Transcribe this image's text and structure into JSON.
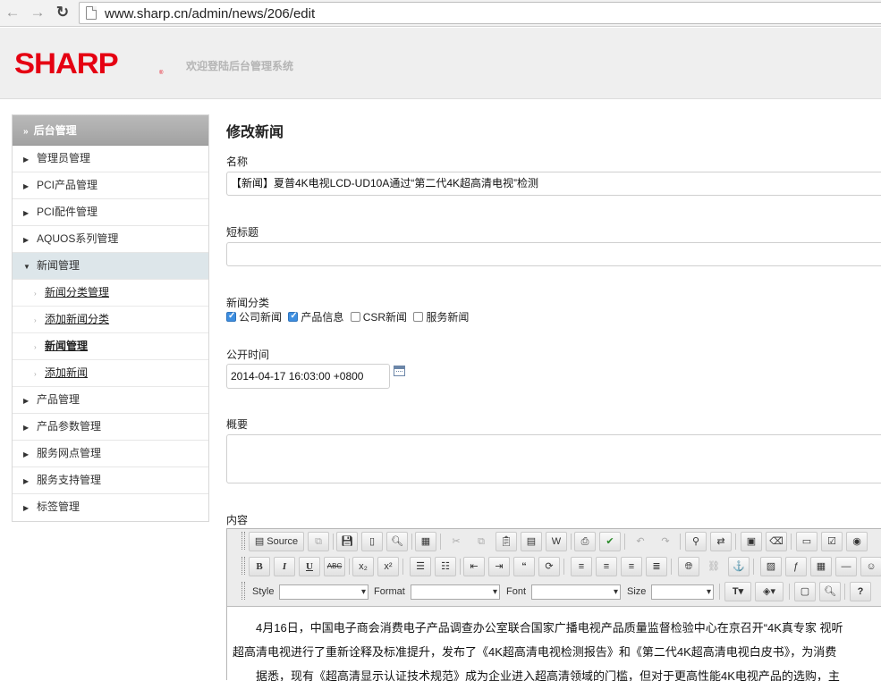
{
  "browser": {
    "url": "www.sharp.cn/admin/news/206/edit"
  },
  "header": {
    "logo_text": "SHARP",
    "logo_mark": "®",
    "welcome": "欢迎登陆后台管理系统"
  },
  "sidebar": {
    "heading": "后台管理",
    "items": [
      {
        "label": "管理员管理"
      },
      {
        "label": "PCI产品管理"
      },
      {
        "label": "PCI配件管理"
      },
      {
        "label": "AQUOS系列管理"
      },
      {
        "label": "新闻管理"
      },
      {
        "label": "产品管理"
      },
      {
        "label": "产品参数管理"
      },
      {
        "label": "服务网点管理"
      },
      {
        "label": "服务支持管理"
      },
      {
        "label": "标签管理"
      }
    ],
    "subitems": [
      {
        "label": "新闻分类管理"
      },
      {
        "label": "添加新闻分类"
      },
      {
        "label": "新闻管理"
      },
      {
        "label": "添加新闻"
      }
    ]
  },
  "form": {
    "title": "修改新闻",
    "name_label": "名称",
    "name_value": "【新闻】夏普4K电视LCD-UD10A通过“第二代4K超高清电视”检测",
    "short_title_label": "短标题",
    "short_title_value": "",
    "category_label": "新闻分类",
    "categories": [
      {
        "label": "公司新闻",
        "checked": true
      },
      {
        "label": "产品信息",
        "checked": true
      },
      {
        "label": "CSR新闻",
        "checked": false
      },
      {
        "label": "服务新闻",
        "checked": false
      }
    ],
    "publish_time_label": "公开时间",
    "publish_time_value": "2014-04-17 16:03:00 +0800",
    "summary_label": "概要",
    "content_label": "内容"
  },
  "editor": {
    "source_label": "Source",
    "style_label": "Style",
    "format_label": "Format",
    "font_label": "Font",
    "size_label": "Size",
    "content_lines": [
      "4月16日，中国电子商会消费电子产品调查办公室联合国家广播电视产品质量监督检验中心在京召开“4K真专家 视听",
      "超高清电视进行了重新诠释及标准提升，发布了《4K超高清电视检测报告》和《第二代4K超高清电视白皮书》，为消费",
      "据悉，现有《超高清显示认证技术规范》成为企业进入超高清领域的门槛，但对于更高性能4K电视产品的选购，主"
    ]
  },
  "colors": {
    "brand_red": "#e50012",
    "checkbox_blue": "#3d8ee0",
    "sidebar_active": "#dde6ea"
  }
}
